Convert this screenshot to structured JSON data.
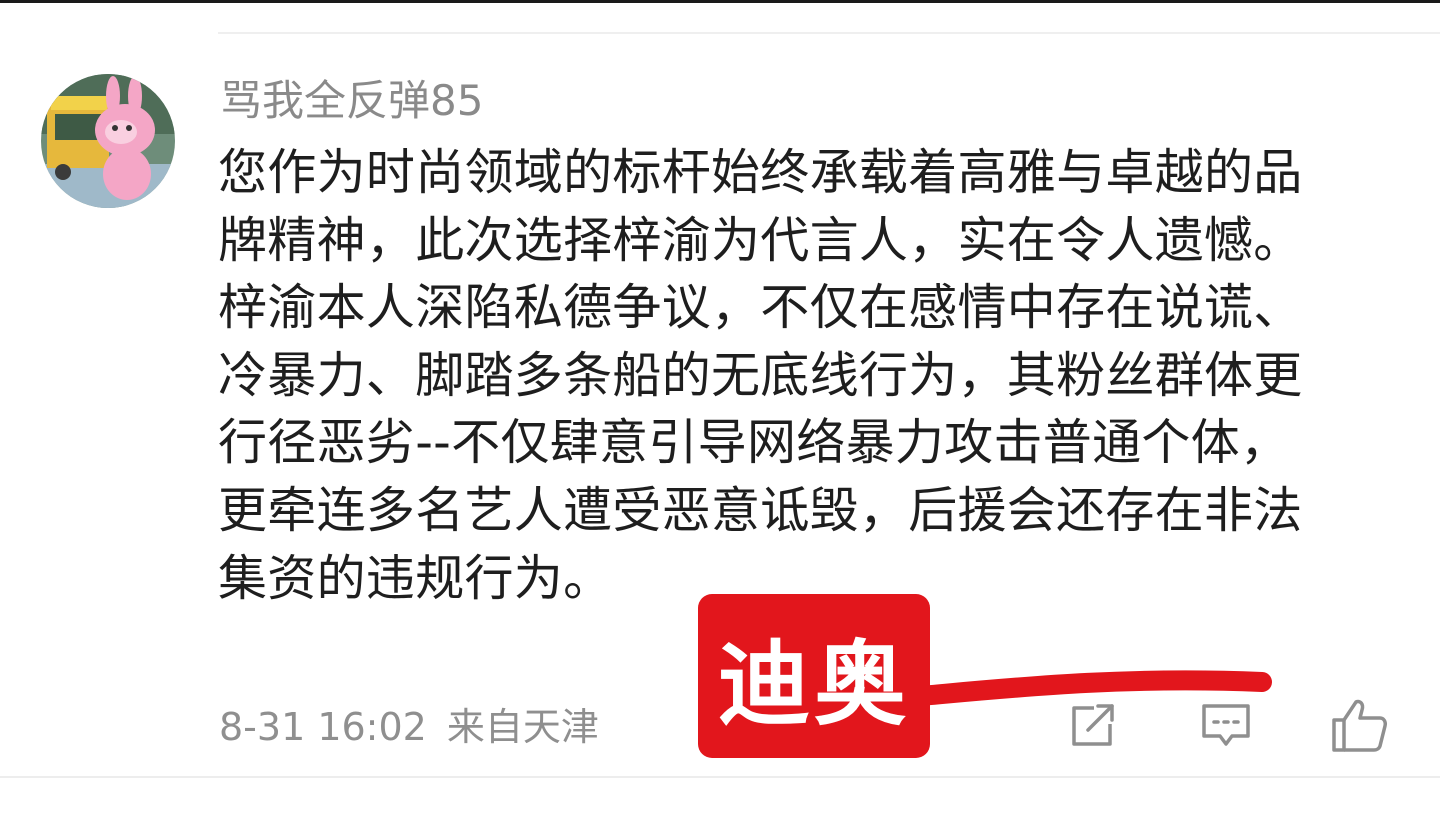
{
  "comment": {
    "username": "骂我全反弹85",
    "text_lines": [
      "您作为时尚领域的标杆始终承载着高雅与卓越的品",
      "牌精神，此次选择梓渝为代言人，实在令人遗憾。",
      "梓渝本人深陷私德争议，不仅在感情中存在说谎、",
      "冷暴力、脚踏多条船的无底线行为，其粉丝群体更",
      "行径恶劣--不仅肆意引导网络暴力攻击普通个体，",
      "更牵连多名艺人遭受恶意诋毁，后援会还存在非法",
      "集资的违规行为。"
    ],
    "timestamp": "8-31 16:02",
    "location": "来自天津"
  },
  "actions": {
    "share_icon": "share-icon",
    "reply_icon": "comment-bubble-icon",
    "like_icon": "thumbs-up-icon"
  },
  "overlay": {
    "badge_text": "迪奥",
    "badge_color": "#e2161c",
    "line_color": "#e2161c"
  },
  "colors": {
    "username": "#8a8a8a",
    "body_text": "#1e1e1e",
    "meta_text": "#8f8f8f"
  }
}
